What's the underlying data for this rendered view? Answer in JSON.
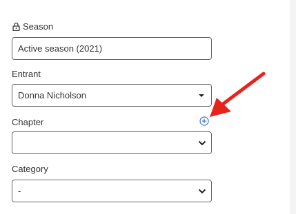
{
  "form": {
    "season": {
      "label": "Season",
      "value": "Active season (2021)"
    },
    "entrant": {
      "label": "Entrant",
      "value": "Donna Nicholson"
    },
    "chapter": {
      "label": "Chapter",
      "value": ""
    },
    "category": {
      "label": "Category",
      "value": "-"
    }
  },
  "icons": {
    "season_lock": "lock-icon",
    "chapter_add": "plus-circle-icon",
    "annotation": "red-arrow"
  },
  "colors": {
    "accent": "#3d6fd1",
    "annotation": "#e8231c",
    "border": "#666666"
  }
}
